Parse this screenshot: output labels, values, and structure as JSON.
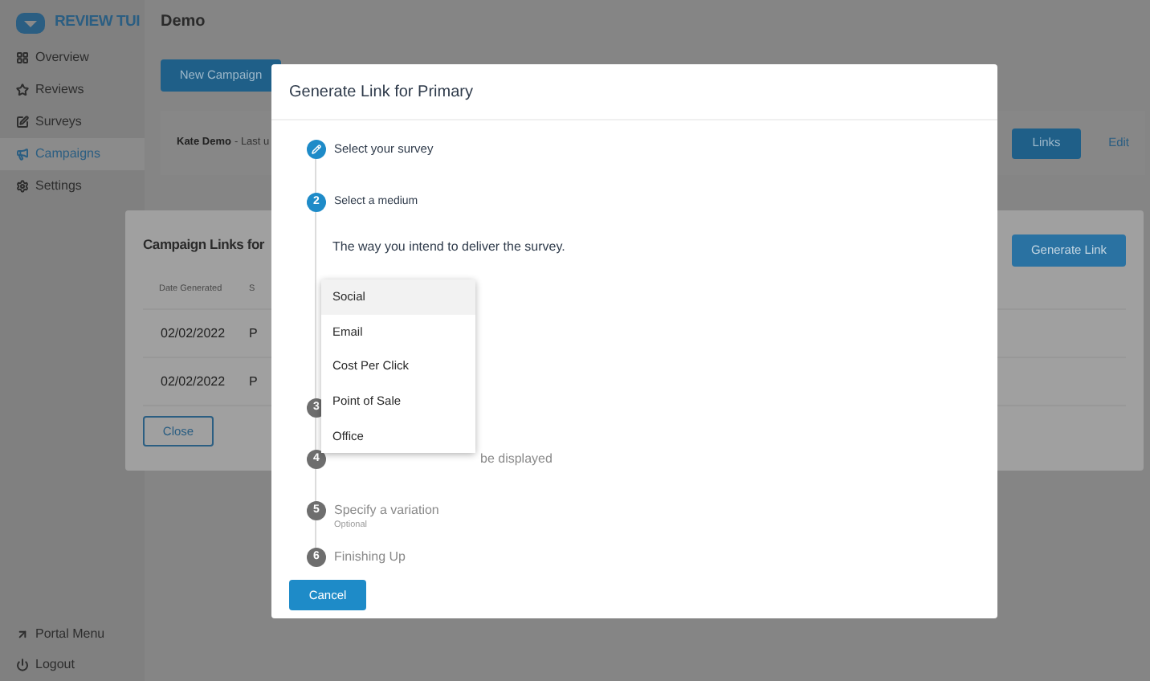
{
  "brand": {
    "name": "REVIEW TUI"
  },
  "page_title": "Demo",
  "sidebar": {
    "items": [
      {
        "label": "Overview",
        "selected": false
      },
      {
        "label": "Reviews",
        "selected": false
      },
      {
        "label": "Surveys",
        "selected": false
      },
      {
        "label": "Campaigns",
        "selected": true
      },
      {
        "label": "Settings",
        "selected": false
      }
    ],
    "footer": [
      {
        "label": "Portal Menu"
      },
      {
        "label": "Logout"
      }
    ]
  },
  "new_campaign_button": "New Campaign",
  "campaign_card": {
    "name": "Kate Demo",
    "meta": "- Last u",
    "links_button": "Links",
    "edit_link": "Edit"
  },
  "campaign_links_dialog": {
    "title": "Campaign Links for",
    "generate_button": "Generate Link",
    "columns": [
      "Date Generated",
      "S"
    ],
    "rows": [
      [
        "02/02/2022",
        "P"
      ],
      [
        "02/02/2022",
        "P"
      ]
    ],
    "close_button": "Close"
  },
  "generate_dialog": {
    "title": "Generate Link for Primary",
    "steps": [
      {
        "kind": "done",
        "label": "Select your survey"
      },
      {
        "kind": "active",
        "number": "2",
        "label": "Select a medium",
        "description": "The way you intend to deliver the survey."
      },
      {
        "kind": "pending",
        "number": "3"
      },
      {
        "kind": "pending",
        "number": "4",
        "label": "be displayed",
        "covered": true
      },
      {
        "kind": "pending",
        "number": "5",
        "label": "Specify a variation",
        "note": "Optional"
      },
      {
        "kind": "pending",
        "number": "6",
        "label": "Finishing Up"
      }
    ],
    "medium_options": [
      {
        "label": "Social",
        "selected": true
      },
      {
        "label": "Email",
        "selected": false
      },
      {
        "label": "Cost Per Click",
        "selected": false
      },
      {
        "label": "Point of Sale",
        "selected": false
      },
      {
        "label": "Office",
        "selected": false
      }
    ],
    "cancel_button": "Cancel"
  }
}
